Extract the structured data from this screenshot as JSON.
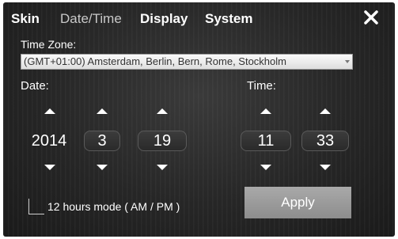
{
  "tabs": [
    {
      "label": "Skin",
      "active": true
    },
    {
      "label": "Date/Time",
      "active": false
    },
    {
      "label": "Display",
      "active": true
    },
    {
      "label": "System",
      "active": true
    }
  ],
  "close_icon": "close-x-icon",
  "timezone": {
    "label": "Time Zone:",
    "value": "(GMT+01:00) Amsterdam, Berlin, Bern, Rome, Stockholm"
  },
  "date": {
    "label": "Date:",
    "year": "2014",
    "month": "3",
    "day": "19"
  },
  "time": {
    "label": "Time:",
    "hour": "11",
    "minute": "33"
  },
  "mode": {
    "label": "12 hours mode ( AM / PM )",
    "checked": false
  },
  "apply_label": "Apply",
  "colors": {
    "background": "#262626",
    "text": "#ffffff",
    "apply_button": "#9b9b9b"
  }
}
